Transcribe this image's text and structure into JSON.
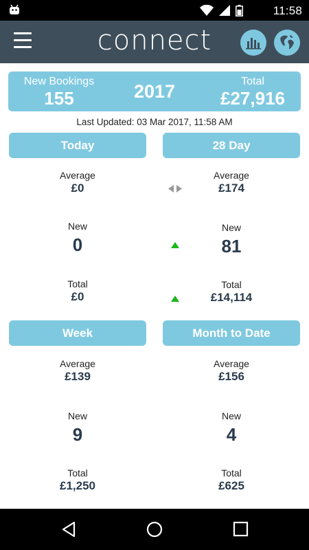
{
  "status_bar": {
    "time": "11:58",
    "icons": [
      "android-icon",
      "wifi-icon",
      "signal-icon",
      "battery-icon"
    ]
  },
  "app_bar": {
    "logo": "connect",
    "icons": [
      "menu-icon",
      "bar-chart-icon",
      "globe-icon"
    ],
    "accent_color": "#7fc9e0",
    "bar_color": "#3e4f5b"
  },
  "summary": {
    "new_bookings_label": "New Bookings",
    "new_bookings_value": "155",
    "year": "2017",
    "total_label": "Total",
    "total_value": "£27,916"
  },
  "last_updated": "Last Updated: 03 Mar 2017, 11:58 AM",
  "sections": {
    "today": {
      "title": "Today",
      "average_label": "Average",
      "average_value": "£0",
      "new_label": "New",
      "new_value": "0",
      "total_label": "Total",
      "total_value": "£0"
    },
    "day28": {
      "title": "28 Day",
      "average_label": "Average",
      "average_value": "£174",
      "new_label": "New",
      "new_value": "81",
      "total_label": "Total",
      "total_value": "£14,114"
    },
    "week": {
      "title": "Week",
      "average_label": "Average",
      "average_value": "£139",
      "new_label": "New",
      "new_value": "9",
      "total_label": "Total",
      "total_value": "£1,250"
    },
    "month": {
      "title": "Month to Date",
      "average_label": "Average",
      "average_value": "£156",
      "new_label": "New",
      "new_value": "4",
      "total_label": "Total",
      "total_value": "£625"
    }
  },
  "indicators": {
    "average": "neutral-icon",
    "new": "trend-up-icon",
    "total": "trend-up-icon",
    "up_color": "#1db51d",
    "neutral_color": "#999999"
  },
  "nav_bar": {
    "icons": [
      "back-icon",
      "home-icon",
      "recents-icon"
    ]
  }
}
